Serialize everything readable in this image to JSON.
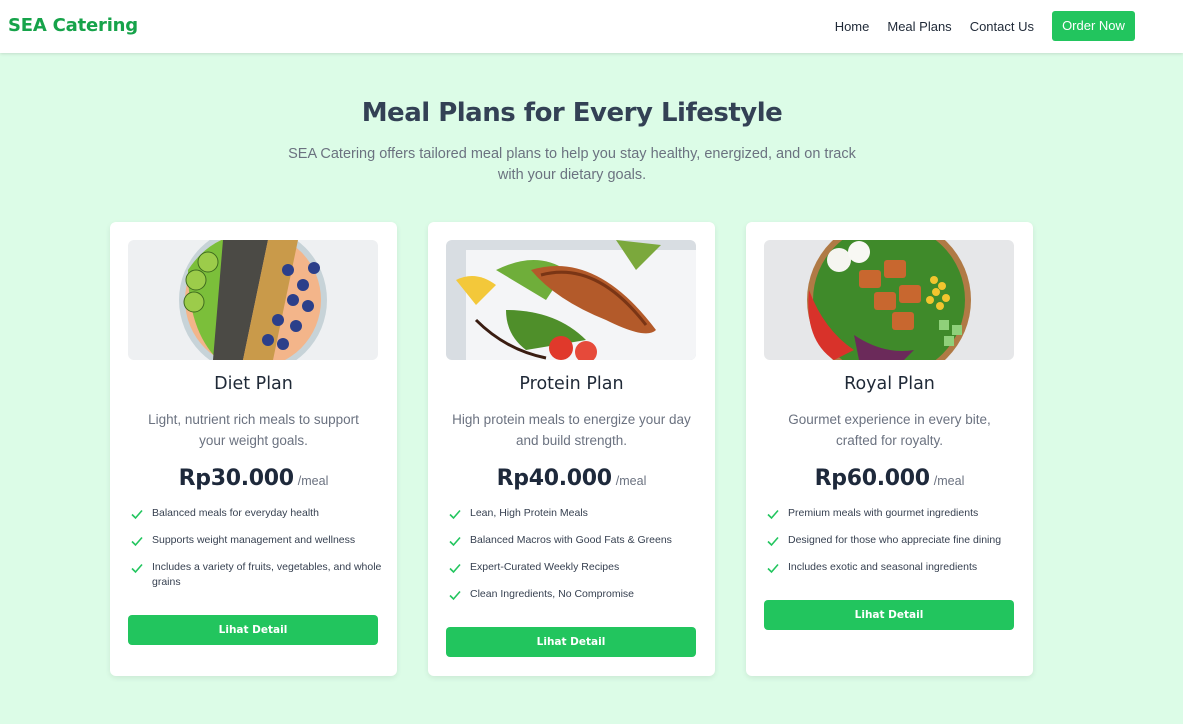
{
  "nav": {
    "brand": "SEA Catering",
    "links": [
      "Home",
      "Meal Plans",
      "Contact Us"
    ],
    "cta": "Order Now"
  },
  "hero": {
    "title": "Meal Plans for Every Lifestyle",
    "subtitle": "SEA Catering offers tailored meal plans to help you stay healthy, energized, and on track with your dietary goals."
  },
  "plans": [
    {
      "image": "diet-bowl-image",
      "title": "Diet Plan",
      "description": "Light, nutrient rich meals to support your weight goals.",
      "price": "Rp30.000",
      "unit": "/meal",
      "features": [
        "Balanced meals for everyday health",
        "Supports weight management and wellness",
        "Includes a variety of fruits, vegetables, and whole grains"
      ],
      "button": "Lihat Detail"
    },
    {
      "image": "salmon-plate-image",
      "title": "Protein Plan",
      "description": "High protein meals to energize your day and build strength.",
      "price": "Rp40.000",
      "unit": "/meal",
      "features": [
        "Lean, High Protein Meals",
        "Balanced Macros with Good Fats & Greens",
        "Expert-Curated Weekly Recipes",
        "Clean Ingredients, No Compromise"
      ],
      "button": "Lihat Detail"
    },
    {
      "image": "salad-bowl-image",
      "title": "Royal Plan",
      "description": "Gourmet experience in every bite, crafted for royalty.",
      "price": "Rp60.000",
      "unit": "/meal",
      "features": [
        "Premium meals with gourmet ingredients",
        "Designed for those who appreciate fine dining",
        "Includes exotic and seasonal ingredients"
      ],
      "button": "Lihat Detail"
    }
  ],
  "colors": {
    "accent": "#22c55e",
    "brand": "#16a34a",
    "background": "#dcfce7"
  }
}
